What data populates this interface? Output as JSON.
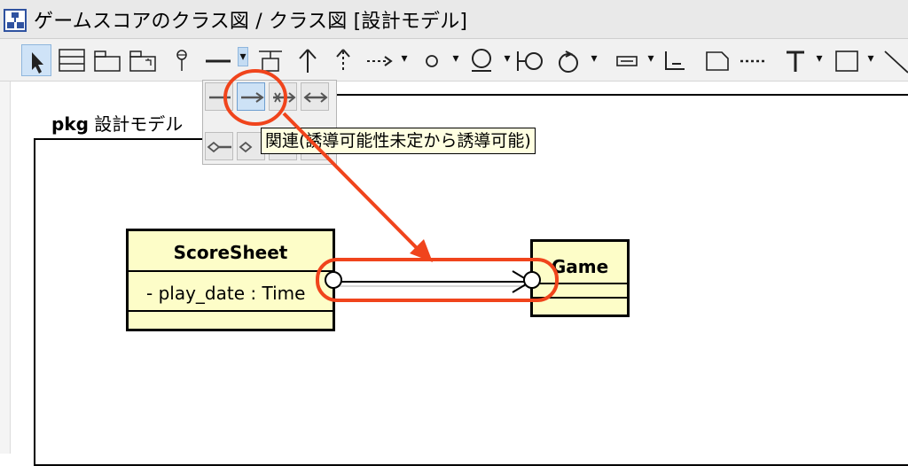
{
  "window": {
    "title": "ゲームスコアのクラス図 / クラス図 [設計モデル]",
    "icon": "class-diagram-icon"
  },
  "toolbar": {
    "tools": [
      "select-pointer-icon",
      "class-icon",
      "package-icon",
      "subsystem-icon",
      "interface-ball-icon",
      "association-line-icon",
      "note-anchor-icon",
      "generalization-icon",
      "realization-icon",
      "dependency-icon",
      "circle-icon",
      "boundary-icon",
      "interface-lollipop-icon",
      "control-icon",
      "entity-icon",
      "rectangle-icon",
      "note-icon",
      "dotted-line-icon",
      "text-icon",
      "frame-icon",
      "line-icon"
    ],
    "selected_tool": "select-pointer-icon",
    "open_dropdown": "association-line-icon"
  },
  "association_popup": {
    "options": [
      "association-icon",
      "navigable-association-icon",
      "non-navigable-association-icon",
      "bidirectional-association-icon",
      "aggregation-icon",
      "composition-icon",
      "aggregation-navigable-icon",
      "composition-navigable-icon"
    ],
    "selected": "navigable-association-icon",
    "tooltip": "関連(誘導可能性未定から誘導可能)"
  },
  "diagram": {
    "package_keyword": "pkg",
    "package_name": "設計モデル",
    "classes": [
      {
        "name": "ScoreSheet",
        "attributes": [
          "- play_date : Time"
        ]
      },
      {
        "name": "Game",
        "attributes": []
      }
    ],
    "association": {
      "from": "ScoreSheet",
      "to": "Game",
      "navigable_end": "Game"
    }
  },
  "annotation": {
    "color": "#f0441c"
  }
}
